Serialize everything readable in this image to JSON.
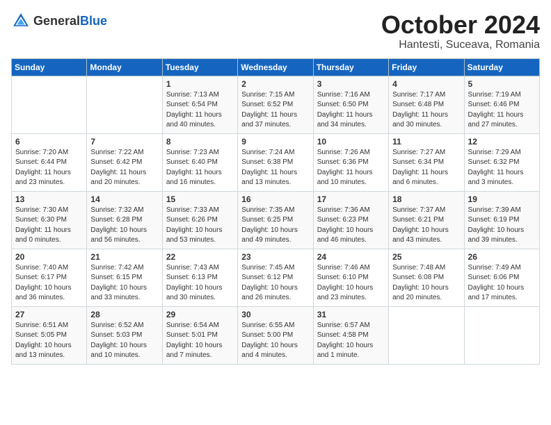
{
  "header": {
    "logo_general": "General",
    "logo_blue": "Blue",
    "month_title": "October 2024",
    "location": "Hantesti, Suceava, Romania"
  },
  "days_of_week": [
    "Sunday",
    "Monday",
    "Tuesday",
    "Wednesday",
    "Thursday",
    "Friday",
    "Saturday"
  ],
  "weeks": [
    [
      {
        "day": "",
        "info": ""
      },
      {
        "day": "",
        "info": ""
      },
      {
        "day": "1",
        "info": "Sunrise: 7:13 AM\nSunset: 6:54 PM\nDaylight: 11 hours and 40 minutes."
      },
      {
        "day": "2",
        "info": "Sunrise: 7:15 AM\nSunset: 6:52 PM\nDaylight: 11 hours and 37 minutes."
      },
      {
        "day": "3",
        "info": "Sunrise: 7:16 AM\nSunset: 6:50 PM\nDaylight: 11 hours and 34 minutes."
      },
      {
        "day": "4",
        "info": "Sunrise: 7:17 AM\nSunset: 6:48 PM\nDaylight: 11 hours and 30 minutes."
      },
      {
        "day": "5",
        "info": "Sunrise: 7:19 AM\nSunset: 6:46 PM\nDaylight: 11 hours and 27 minutes."
      }
    ],
    [
      {
        "day": "6",
        "info": "Sunrise: 7:20 AM\nSunset: 6:44 PM\nDaylight: 11 hours and 23 minutes."
      },
      {
        "day": "7",
        "info": "Sunrise: 7:22 AM\nSunset: 6:42 PM\nDaylight: 11 hours and 20 minutes."
      },
      {
        "day": "8",
        "info": "Sunrise: 7:23 AM\nSunset: 6:40 PM\nDaylight: 11 hours and 16 minutes."
      },
      {
        "day": "9",
        "info": "Sunrise: 7:24 AM\nSunset: 6:38 PM\nDaylight: 11 hours and 13 minutes."
      },
      {
        "day": "10",
        "info": "Sunrise: 7:26 AM\nSunset: 6:36 PM\nDaylight: 11 hours and 10 minutes."
      },
      {
        "day": "11",
        "info": "Sunrise: 7:27 AM\nSunset: 6:34 PM\nDaylight: 11 hours and 6 minutes."
      },
      {
        "day": "12",
        "info": "Sunrise: 7:29 AM\nSunset: 6:32 PM\nDaylight: 11 hours and 3 minutes."
      }
    ],
    [
      {
        "day": "13",
        "info": "Sunrise: 7:30 AM\nSunset: 6:30 PM\nDaylight: 11 hours and 0 minutes."
      },
      {
        "day": "14",
        "info": "Sunrise: 7:32 AM\nSunset: 6:28 PM\nDaylight: 10 hours and 56 minutes."
      },
      {
        "day": "15",
        "info": "Sunrise: 7:33 AM\nSunset: 6:26 PM\nDaylight: 10 hours and 53 minutes."
      },
      {
        "day": "16",
        "info": "Sunrise: 7:35 AM\nSunset: 6:25 PM\nDaylight: 10 hours and 49 minutes."
      },
      {
        "day": "17",
        "info": "Sunrise: 7:36 AM\nSunset: 6:23 PM\nDaylight: 10 hours and 46 minutes."
      },
      {
        "day": "18",
        "info": "Sunrise: 7:37 AM\nSunset: 6:21 PM\nDaylight: 10 hours and 43 minutes."
      },
      {
        "day": "19",
        "info": "Sunrise: 7:39 AM\nSunset: 6:19 PM\nDaylight: 10 hours and 39 minutes."
      }
    ],
    [
      {
        "day": "20",
        "info": "Sunrise: 7:40 AM\nSunset: 6:17 PM\nDaylight: 10 hours and 36 minutes."
      },
      {
        "day": "21",
        "info": "Sunrise: 7:42 AM\nSunset: 6:15 PM\nDaylight: 10 hours and 33 minutes."
      },
      {
        "day": "22",
        "info": "Sunrise: 7:43 AM\nSunset: 6:13 PM\nDaylight: 10 hours and 30 minutes."
      },
      {
        "day": "23",
        "info": "Sunrise: 7:45 AM\nSunset: 6:12 PM\nDaylight: 10 hours and 26 minutes."
      },
      {
        "day": "24",
        "info": "Sunrise: 7:46 AM\nSunset: 6:10 PM\nDaylight: 10 hours and 23 minutes."
      },
      {
        "day": "25",
        "info": "Sunrise: 7:48 AM\nSunset: 6:08 PM\nDaylight: 10 hours and 20 minutes."
      },
      {
        "day": "26",
        "info": "Sunrise: 7:49 AM\nSunset: 6:06 PM\nDaylight: 10 hours and 17 minutes."
      }
    ],
    [
      {
        "day": "27",
        "info": "Sunrise: 6:51 AM\nSunset: 5:05 PM\nDaylight: 10 hours and 13 minutes."
      },
      {
        "day": "28",
        "info": "Sunrise: 6:52 AM\nSunset: 5:03 PM\nDaylight: 10 hours and 10 minutes."
      },
      {
        "day": "29",
        "info": "Sunrise: 6:54 AM\nSunset: 5:01 PM\nDaylight: 10 hours and 7 minutes."
      },
      {
        "day": "30",
        "info": "Sunrise: 6:55 AM\nSunset: 5:00 PM\nDaylight: 10 hours and 4 minutes."
      },
      {
        "day": "31",
        "info": "Sunrise: 6:57 AM\nSunset: 4:58 PM\nDaylight: 10 hours and 1 minute."
      },
      {
        "day": "",
        "info": ""
      },
      {
        "day": "",
        "info": ""
      }
    ]
  ]
}
